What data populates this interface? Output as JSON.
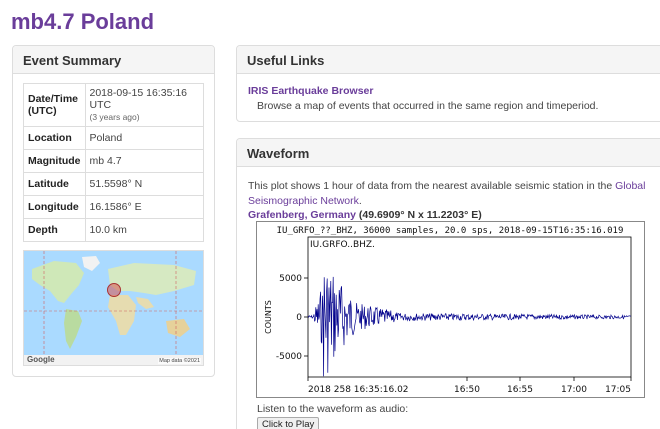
{
  "page": {
    "title": "mb4.7 Poland"
  },
  "event_summary": {
    "heading": "Event Summary",
    "rows": [
      {
        "label": "Date/Time (UTC)",
        "value": "2018-09-15 16:35:16 UTC",
        "sub": "(3 years ago)"
      },
      {
        "label": "Location",
        "value": "Poland"
      },
      {
        "label": "Magnitude",
        "value": "mb 4.7"
      },
      {
        "label": "Latitude",
        "value": "51.5598° N"
      },
      {
        "label": "Longitude",
        "value": "16.1586° E"
      },
      {
        "label": "Depth",
        "value": "10.0 km"
      }
    ],
    "map": {
      "google": "Google",
      "attribution": "Map data ©2021"
    }
  },
  "useful_links": {
    "heading": "Useful Links",
    "link_label": "IRIS Earthquake Browser",
    "link_desc": "Browse a map of events that occurred in the same region and timeperiod."
  },
  "waveform": {
    "heading": "Waveform",
    "desc_pre": "This plot shows 1 hour of data from the nearest available seismic station in the",
    "desc_link": "Global Seismographic Network",
    "desc_post": ".",
    "station_name": "Grafenberg, Germany",
    "station_coords": "(49.6909° N x 11.2203° E)",
    "plot_title": "IU_GRFO_??_BHZ, 36000 samples, 20.0 sps, 2018-09-15T16:35:16.019",
    "trace_label": "IU.GRFO..BHZ.",
    "ylabel": "COUNTS",
    "yticks": [
      "5000",
      "0",
      "-5000"
    ],
    "xticks": [
      "2018 258 16:35:16.02",
      "16:50",
      "16:55",
      "17:00",
      "17:05"
    ],
    "audio_label": "Listen to the waveform as audio:",
    "play_button": "Click to Play"
  },
  "colors": {
    "accent": "#6a3d9a",
    "trace": "#00008b",
    "epicenter": "#d9534f"
  }
}
